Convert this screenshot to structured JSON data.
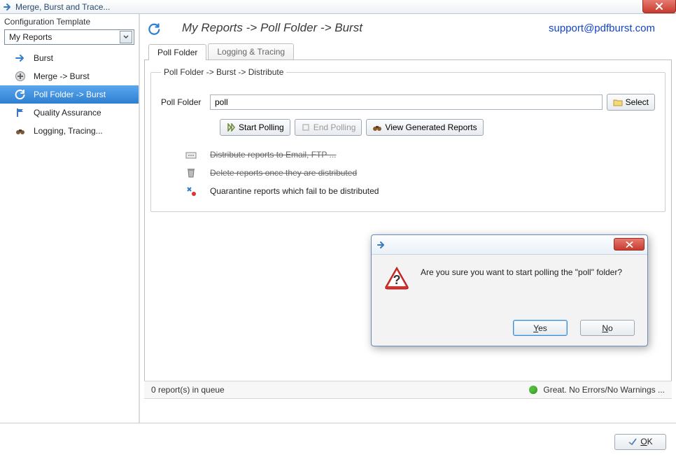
{
  "window": {
    "title": "Merge, Burst and Trace..."
  },
  "sidebar": {
    "header": "Configuration Template",
    "combo_value": "My Reports",
    "items": [
      {
        "label": "Burst"
      },
      {
        "label": "Merge -> Burst"
      },
      {
        "label": "Poll Folder -> Burst"
      },
      {
        "label": "Quality Assurance"
      },
      {
        "label": "Logging, Tracing..."
      }
    ],
    "selected_index": 2
  },
  "header": {
    "breadcrumb": "My Reports -> Poll Folder -> Burst",
    "support_link": "support@pdfburst.com"
  },
  "tabs": [
    {
      "label": "Poll Folder",
      "active": true
    },
    {
      "label": "Logging & Tracing",
      "active": false
    }
  ],
  "group": {
    "legend": "Poll Folder -> Burst -> Distribute",
    "poll_label": "Poll Folder",
    "poll_value": "poll",
    "select_btn": "Select",
    "start_btn": "Start Polling",
    "end_btn": "End Polling",
    "view_btn": "View Generated Reports",
    "options": [
      {
        "text": "Distribute reports to Email, FTP ...",
        "strike": true
      },
      {
        "text": "Delete reports once they are distributed",
        "strike": true
      },
      {
        "text": "Quarantine reports which fail to be distributed",
        "strike": false
      }
    ]
  },
  "status": {
    "queue": "0 report(s) in queue",
    "right": "Great. No Errors/No Warnings ..."
  },
  "ok_label": "OK",
  "dialog": {
    "message": "Are you sure you want to start polling the \"poll\" folder?",
    "yes": "Yes",
    "no": "No"
  }
}
